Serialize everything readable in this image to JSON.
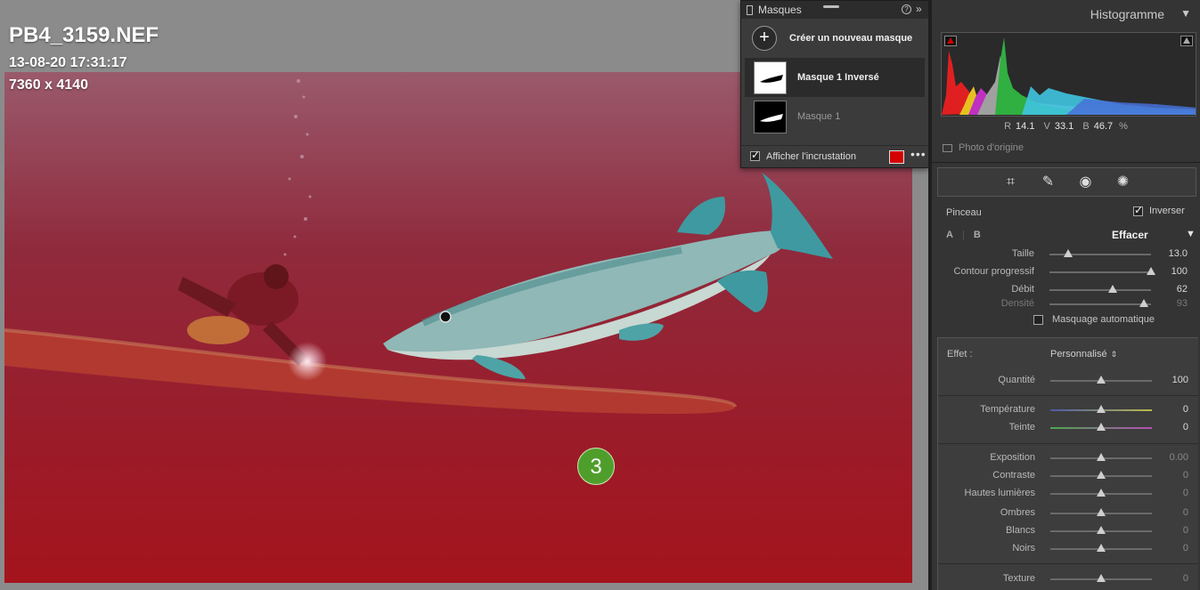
{
  "photo_info": {
    "filename": "PB4_3159.NEF",
    "datetime": "13-08-20 17:31:17",
    "dimensions": "7360 x 4140"
  },
  "callout": {
    "number": "3",
    "color": "#4f9e2b"
  },
  "masks_panel": {
    "title": "Masques",
    "create_label": "Créer un nouveau masque",
    "items": [
      {
        "label": "Masque 1 Inversé",
        "selected": true,
        "thumb": "white-with-black-fish"
      },
      {
        "label": "Masque 1",
        "selected": false,
        "thumb": "black-with-white-fish"
      }
    ],
    "overlay_label": "Afficher l'incrustation",
    "overlay_checked": true,
    "overlay_color": "#d40000"
  },
  "histogram": {
    "title": "Histogramme",
    "r_label": "R",
    "r_value": "14.1",
    "v_label": "V",
    "v_value": "33.1",
    "b_label": "B",
    "b_value": "46.7",
    "unit": "%",
    "original_label": "Photo d'origine"
  },
  "tools": [
    "crop-icon",
    "heal-icon",
    "redeye-icon",
    "mask-icon"
  ],
  "brush": {
    "title": "Pinceau",
    "invert_label": "Inverser",
    "invert_checked": true,
    "a_label": "A",
    "b_label": "B",
    "mode_label": "Effacer",
    "sliders": [
      {
        "label": "Taille",
        "value": "13.0",
        "pos": 0.18
      },
      {
        "label": "Contour progressif",
        "value": "100",
        "pos": 1.0
      },
      {
        "label": "Débit",
        "value": "62",
        "pos": 0.62
      },
      {
        "label": "Densité",
        "value": "93",
        "pos": 0.93,
        "dim": true
      }
    ],
    "auto_mask_label": "Masquage automatique"
  },
  "effect": {
    "label": "Effet :",
    "preset": "Personnalisé",
    "sliders": [
      {
        "label": "Quantité",
        "value": "100",
        "pos": 0.5
      },
      {
        "label": "Température",
        "value": "0",
        "pos": 0.5,
        "track": "temp"
      },
      {
        "label": "Teinte",
        "value": "0",
        "pos": 0.5,
        "track": "tint"
      },
      {
        "label": "Exposition",
        "value": "0.00",
        "pos": 0.5
      },
      {
        "label": "Contraste",
        "value": "0",
        "pos": 0.5
      },
      {
        "label": "Hautes lumières",
        "value": "0",
        "pos": 0.5
      },
      {
        "label": "Ombres",
        "value": "0",
        "pos": 0.5
      },
      {
        "label": "Blancs",
        "value": "0",
        "pos": 0.5
      },
      {
        "label": "Noirs",
        "value": "0",
        "pos": 0.5
      },
      {
        "label": "Texture",
        "value": "0",
        "pos": 0.5
      }
    ]
  }
}
